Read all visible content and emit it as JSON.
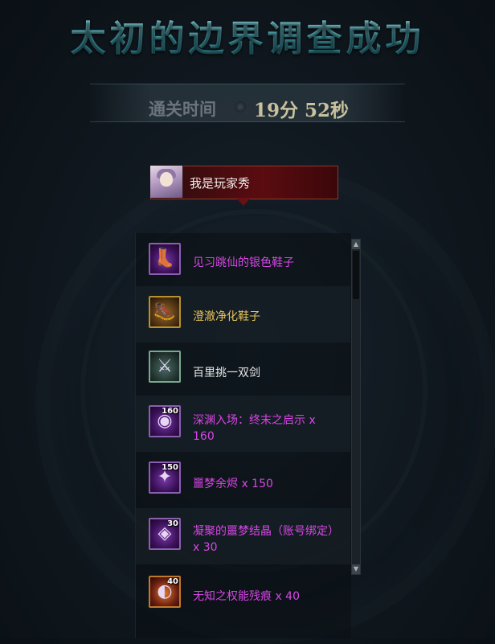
{
  "title": "太初的边界调查成功",
  "clear_time": {
    "label": "通关时间",
    "value": "19分 52秒"
  },
  "player": {
    "name": "我是玩家秀"
  },
  "rewards": [
    {
      "name": "见习跳仙的银色鞋子",
      "quantity_badge": "",
      "rarity": "epic",
      "icon": "boots-icon"
    },
    {
      "name": "澄澈净化鞋子",
      "quantity_badge": "",
      "rarity": "legendary",
      "icon": "boots-icon"
    },
    {
      "name": "百里挑一双剑",
      "quantity_badge": "",
      "rarity": "normal",
      "icon": "sword-icon"
    },
    {
      "name": "深渊入场：终末之启示 x 160",
      "quantity_badge": "160",
      "rarity": "epic",
      "icon": "orb-icon"
    },
    {
      "name": "噩梦余烬 x 150",
      "quantity_badge": "150",
      "rarity": "epic",
      "icon": "ember-icon"
    },
    {
      "name": "凝聚的噩梦结晶（账号绑定）x 30",
      "quantity_badge": "30",
      "rarity": "epic",
      "icon": "crystal-icon"
    },
    {
      "name": "无知之权能残痕 x 40",
      "quantity_badge": "40",
      "rarity": "epic",
      "icon": "fragment-icon"
    }
  ],
  "colors": {
    "title": "#6fb7c0",
    "epic": "#d746e6",
    "legendary": "#e6c35a",
    "normal": "#e8e8e8",
    "player_tag": "#5a0c10"
  }
}
